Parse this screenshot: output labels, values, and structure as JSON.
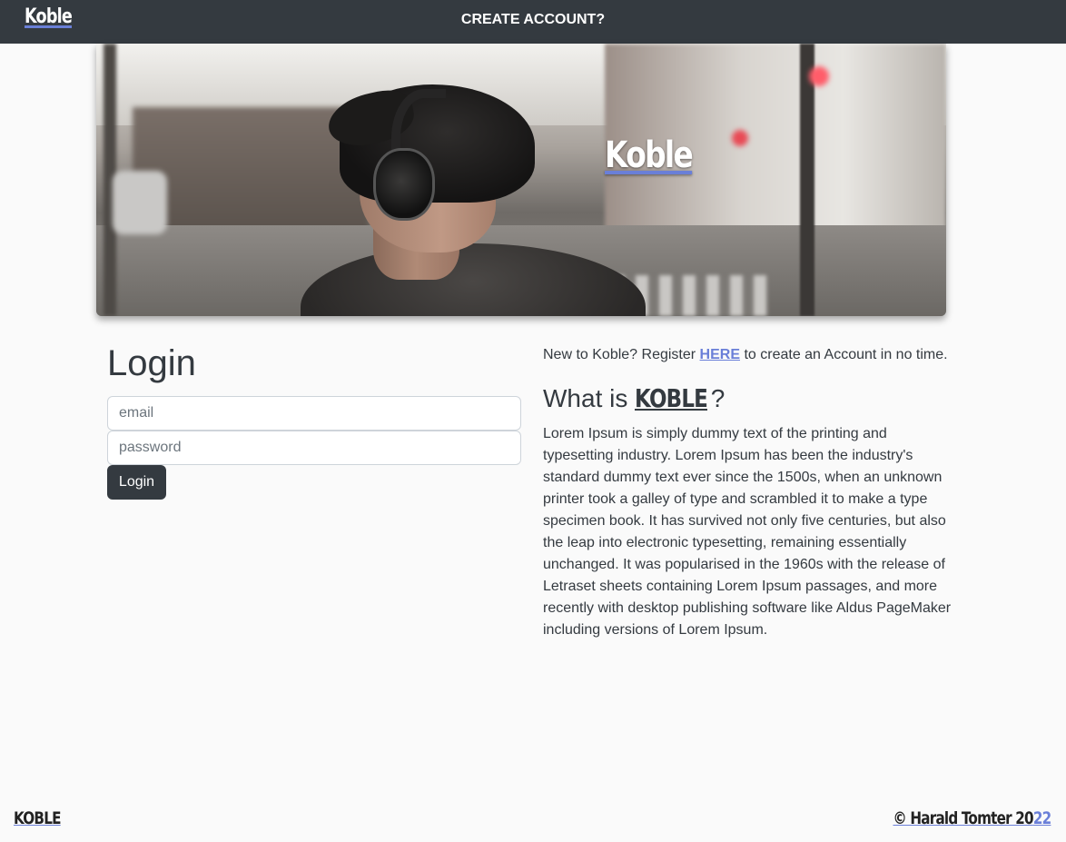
{
  "navbar": {
    "brand": "Koble",
    "create_account": "CREATE ACCOUNT?"
  },
  "hero": {
    "title": "Koble"
  },
  "login": {
    "heading": "Login",
    "email_placeholder": "email",
    "password_placeholder": "password",
    "button_label": "Login"
  },
  "register": {
    "prefix": "New to Koble? Register",
    "link": "HERE",
    "suffix": "to create an Account in no time."
  },
  "about": {
    "heading_prefix": "What is",
    "heading_brand": "KOBLE",
    "heading_suffix": "?",
    "body": "Lorem Ipsum is simply dummy text of the printing and typesetting industry. Lorem Ipsum has been the industry's standard dummy text ever since the 1500s, when an unknown printer took a galley of type and scrambled it to make a type specimen book. It has survived not only five centuries, but also the leap into electronic typesetting, remaining essentially unchanged. It was popularised in the 1960s with the release of Letraset sheets containing Lorem Ipsum passages, and more recently with desktop publishing software like Aldus PageMaker including versions of Lorem Ipsum."
  },
  "footer": {
    "left": "KOBLE",
    "copyright_main": "© Harald Tomter 20",
    "copyright_end": "22"
  },
  "colors": {
    "navbar_bg": "#343a40",
    "accent": "#6a7fd8",
    "page_bg": "#fafafa"
  }
}
